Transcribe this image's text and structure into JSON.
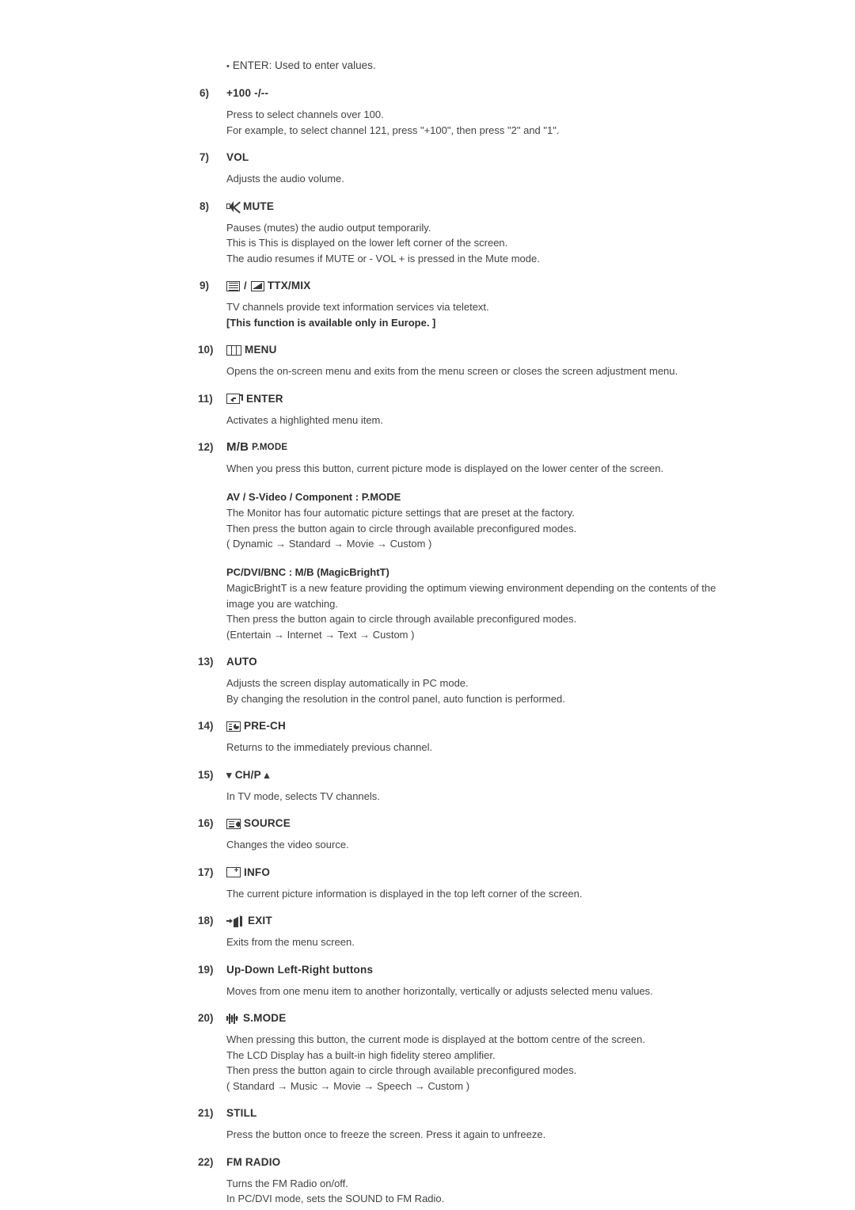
{
  "intro": {
    "bullet": "ENTER: Used to enter values."
  },
  "entries": [
    {
      "num": "6)",
      "icon": "none",
      "title": "+100 -/--",
      "lines": [
        "Press to select channels over 100.",
        "For example, to select channel 121, press \"+100\", then press \"2\" and \"1\"."
      ]
    },
    {
      "num": "7)",
      "icon": "none",
      "title": "VOL",
      "lines": [
        "Adjusts the audio volume."
      ]
    },
    {
      "num": "8)",
      "icon": "mute-icon",
      "title": "MUTE",
      "lines": [
        "Pauses (mutes) the audio output temporarily.",
        "This is This is displayed on the lower left corner of the screen.",
        "The audio resumes if MUTE or - VOL + is pressed in the Mute mode."
      ]
    },
    {
      "num": "9)",
      "icon": "ttx-mix-icon",
      "title": "TTX/MIX",
      "lines": [
        "TV channels provide text information services via teletext."
      ],
      "bold_lines": [
        "[This function is available only in Europe. ]"
      ]
    },
    {
      "num": "10)",
      "icon": "menu-icon",
      "title": "MENU",
      "lines": [
        "Opens the on-screen menu and exits from the menu screen or closes the screen adjustment menu."
      ]
    },
    {
      "num": "11)",
      "icon": "enter-icon",
      "title": "ENTER",
      "lines": [
        "Activates a highlighted menu item."
      ]
    },
    {
      "num": "12)",
      "icon": "none",
      "title_big": "M/B",
      "title_small": "P.MODE",
      "lines": [
        "When you press this button, current picture mode is displayed on the lower center of the screen."
      ],
      "subblocks": [
        {
          "head": "AV / S-Video / Component : P.MODE",
          "lines": [
            "The Monitor has four automatic picture settings that are preset at the factory.",
            "Then press the button again to circle through available preconfigured modes.",
            "( Dynamic → Standard → Movie → Custom )"
          ]
        },
        {
          "head": "PC/DVI/BNC : M/B (MagicBrightT)",
          "lines": [
            "MagicBrightT is a new feature providing the optimum viewing environment depending on the contents of the",
            "image you are watching.",
            "Then press the button again to circle through available preconfigured modes.",
            "(Entertain → Internet → Text → Custom )"
          ]
        }
      ]
    },
    {
      "num": "13)",
      "icon": "none",
      "title": "AUTO",
      "lines": [
        "Adjusts the screen display automatically in PC mode.",
        "By changing the resolution in the control panel, auto function is performed."
      ]
    },
    {
      "num": "14)",
      "icon": "pre-ch-icon",
      "title": "PRE-CH",
      "lines": [
        "Returns to the immediately previous channel."
      ]
    },
    {
      "num": "15)",
      "icon": "chevron-down-icon",
      "title": "CH/P",
      "icon_after": "chevron-up-icon",
      "lines": [
        "In TV mode, selects TV channels."
      ]
    },
    {
      "num": "16)",
      "icon": "source-icon",
      "title": "SOURCE",
      "lines": [
        "Changes the video source."
      ]
    },
    {
      "num": "17)",
      "icon": "info-icon",
      "title": "INFO",
      "lines": [
        "The current picture information is displayed in the top left corner of the screen."
      ]
    },
    {
      "num": "18)",
      "icon": "exit-icon",
      "title": "EXIT",
      "lines": [
        "Exits from the menu screen."
      ]
    },
    {
      "num": "19)",
      "icon": "none",
      "title": "Up-Down Left-Right buttons",
      "lines": [
        "Moves from one menu item to another horizontally, vertically or adjusts selected menu values."
      ]
    },
    {
      "num": "20)",
      "icon": "s-mode-icon",
      "title": "S.MODE",
      "lines": [
        "When pressing this button, the current mode is displayed at the bottom centre of the screen.",
        "The LCD Display has a built-in high fidelity stereo amplifier.",
        "Then press the button again to circle through available preconfigured modes.",
        "( Standard → Music → Movie → Speech → Custom )"
      ]
    },
    {
      "num": "21)",
      "icon": "none",
      "title": "STILL",
      "lines": [
        "Press the button once to freeze the screen. Press it again to unfreeze."
      ]
    },
    {
      "num": "22)",
      "icon": "none",
      "title": "FM RADIO",
      "lines": [
        "Turns the FM Radio on/off.",
        "In PC/DVI mode, sets the SOUND to FM Radio."
      ]
    }
  ]
}
